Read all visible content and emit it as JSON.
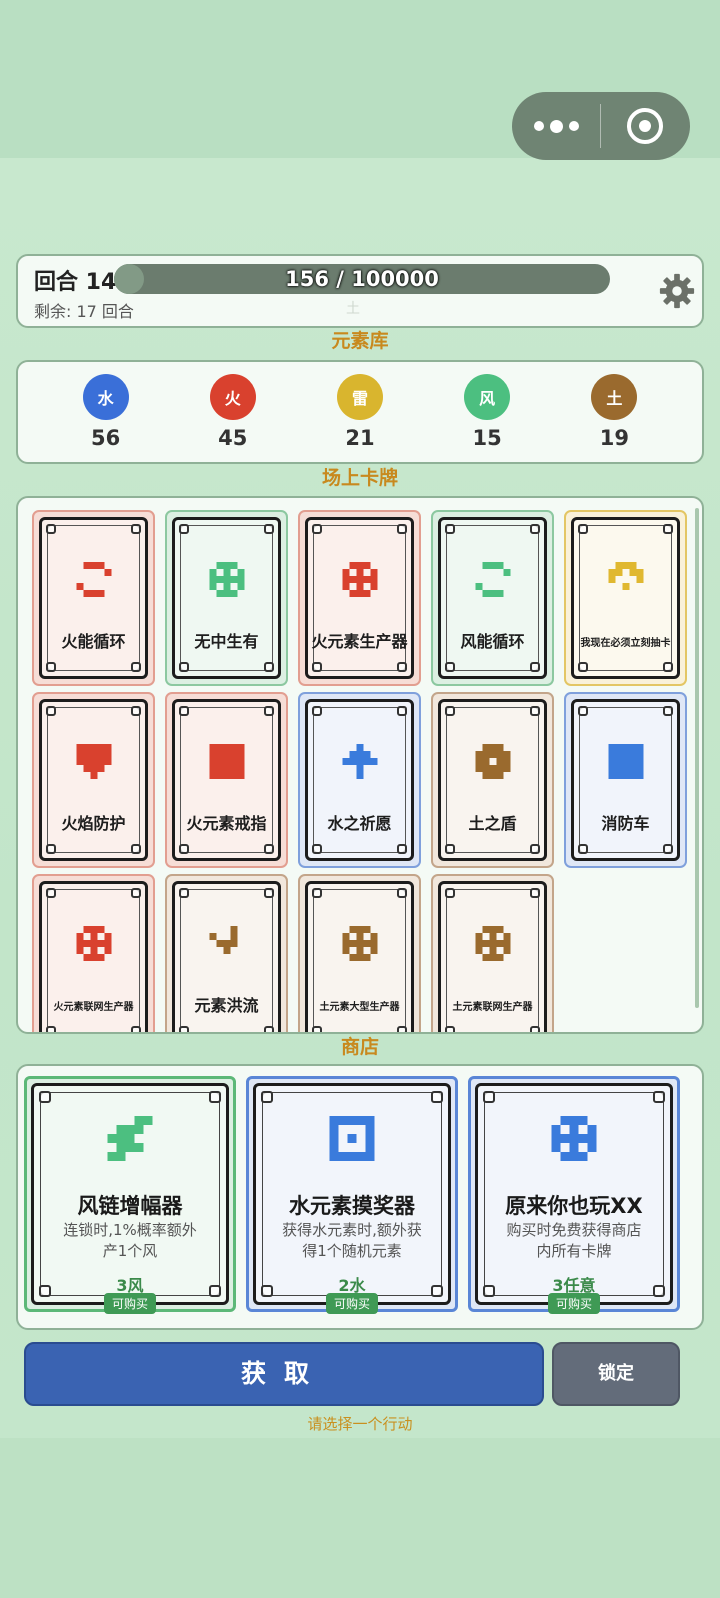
{
  "capsule": {
    "more_icon": "more-dots-icon",
    "close_icon": "target-icon"
  },
  "header": {
    "round_label": "回合 14",
    "remaining_label": "剩余: 17 回合",
    "progress_text": "156 / 100000",
    "progress_value": 156,
    "progress_max": 100000,
    "ghost_text": "土",
    "settings_icon": "gear-icon"
  },
  "sections": {
    "element_pool": "元素库",
    "field_cards": "场上卡牌",
    "shop": "商店"
  },
  "elements": [
    {
      "label": "水",
      "count": "56",
      "color": "#3a6fd8"
    },
    {
      "label": "火",
      "count": "45",
      "color": "#d9412e"
    },
    {
      "label": "雷",
      "count": "21",
      "color": "#d9b52e"
    },
    {
      "label": "风",
      "count": "15",
      "color": "#4cbf80"
    },
    {
      "label": "土",
      "count": "19",
      "color": "#9a6a2e"
    }
  ],
  "cards": [
    {
      "name": "火能循环",
      "theme": "red",
      "icon": "cycle-icon",
      "icon_color": "#d9412e"
    },
    {
      "name": "无中生有",
      "theme": "green",
      "icon": "grid-icon",
      "icon_color": "#4cbf80"
    },
    {
      "name": "火元素生产器",
      "theme": "red",
      "icon": "grid-icon",
      "icon_color": "#d9412e"
    },
    {
      "name": "风能循环",
      "theme": "green",
      "icon": "cycle-icon",
      "icon_color": "#4cbf80"
    },
    {
      "name": "我现在必须立刻抽卡",
      "theme": "yellow",
      "icon": "arch-icon",
      "icon_color": "#e0b830"
    },
    {
      "name": "火焰防护",
      "theme": "red",
      "icon": "shield-icon",
      "icon_color": "#d9412e"
    },
    {
      "name": "火元素戒指",
      "theme": "red",
      "icon": "square-icon",
      "icon_color": "#d9412e"
    },
    {
      "name": "水之祈愿",
      "theme": "blue",
      "icon": "arrow-up-icon",
      "icon_color": "#3a7bdc"
    },
    {
      "name": "土之盾",
      "theme": "brown",
      "icon": "ring-icon",
      "icon_color": "#9a6a2e"
    },
    {
      "name": "消防车",
      "theme": "blue",
      "icon": "square-icon",
      "icon_color": "#3a7bdc"
    },
    {
      "name": "火元素联网生产器",
      "theme": "red",
      "icon": "grid-icon",
      "icon_color": "#d9412e"
    },
    {
      "name": "元素洪流",
      "theme": "brown",
      "icon": "wave-icon",
      "icon_color": "#9a6a2e"
    },
    {
      "name": "土元素大型生产器",
      "theme": "brown",
      "icon": "grid-icon",
      "icon_color": "#9a6a2e"
    },
    {
      "name": "土元素联网生产器",
      "theme": "brown",
      "icon": "grid-icon",
      "icon_color": "#9a6a2e"
    }
  ],
  "shop": [
    {
      "title": "风链增幅器",
      "desc": "连锁时,1%概率额外产1个风",
      "price": "3风",
      "status": "可购买",
      "theme": "green",
      "icon": "chain-icon",
      "icon_color": "#4cbf80"
    },
    {
      "title": "水元素摸奖器",
      "desc": "获得水元素时,额外获得1个随机元素",
      "price": "2水",
      "status": "可购买",
      "theme": "blue",
      "icon": "hollow-square-icon",
      "icon_color": "#3a7bdc"
    },
    {
      "title": "原来你也玩XX",
      "desc": "购买时免费获得商店内所有卡牌",
      "price": "3任意",
      "status": "可购买",
      "theme": "blue",
      "icon": "grid-icon",
      "icon_color": "#3a7bdc"
    }
  ],
  "actions": {
    "get_label": "获取",
    "lock_label": "锁定",
    "hint": "请选择一个行动"
  }
}
